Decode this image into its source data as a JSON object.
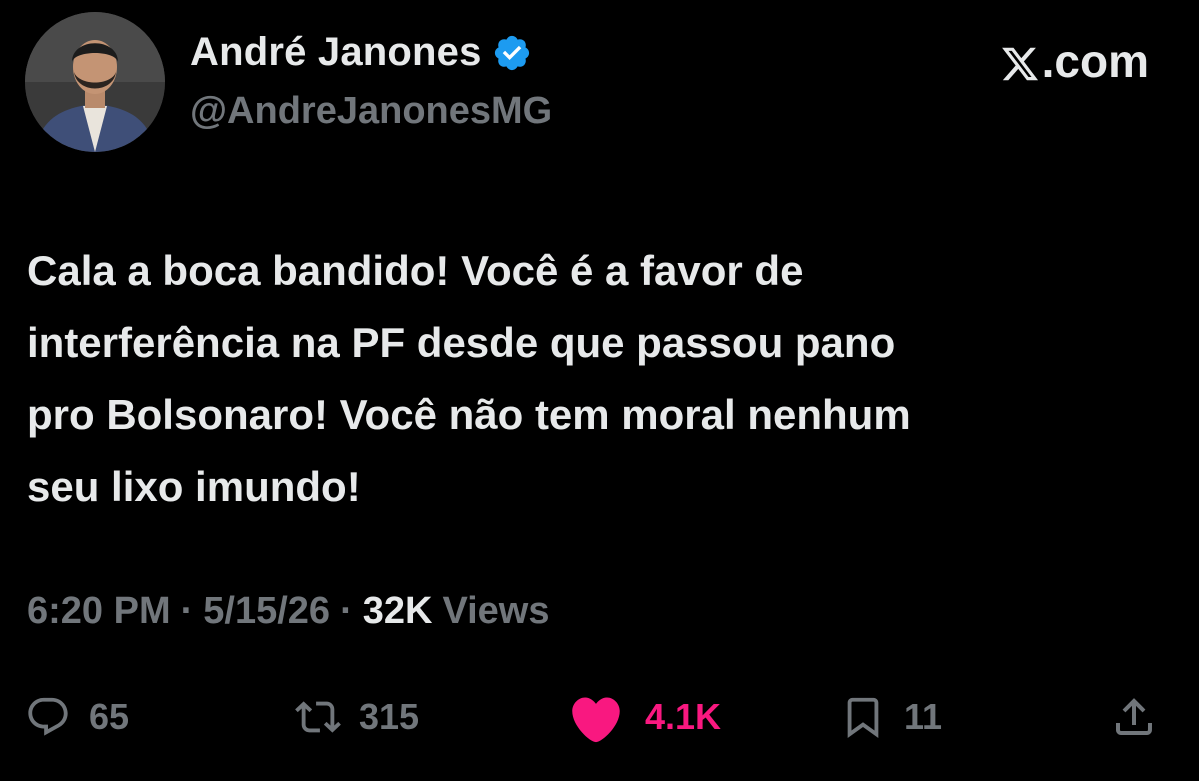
{
  "author": {
    "display_name": "André Janones",
    "handle": "@AndreJanonesMG",
    "verified": true,
    "verified_color": "#1d9bf0"
  },
  "brand": {
    "label": ".com",
    "icon": "x-logo-icon"
  },
  "tweet": {
    "text": "Cala a boca bandido! Você é a favor de\ninterferência na  PF desde que passou pano\npro Bolsonaro! Você não tem moral nenhum\nseu lixo imundo!"
  },
  "meta": {
    "time": "6:20 PM",
    "separator": "·",
    "date": "5/15/26",
    "views_count": "32K",
    "views_label": "Views"
  },
  "actions": {
    "replies": {
      "icon": "reply-icon",
      "count": "65"
    },
    "reposts": {
      "icon": "repost-icon",
      "count": "315"
    },
    "likes": {
      "icon": "heart-icon",
      "count": "4.1K",
      "liked": true,
      "color": "#f91880"
    },
    "bookmarks": {
      "icon": "bookmark-icon",
      "count": "11"
    },
    "share": {
      "icon": "share-icon"
    }
  },
  "colors": {
    "background": "#000000",
    "primary_text": "#e7e9ea",
    "secondary_text": "#71767b"
  }
}
